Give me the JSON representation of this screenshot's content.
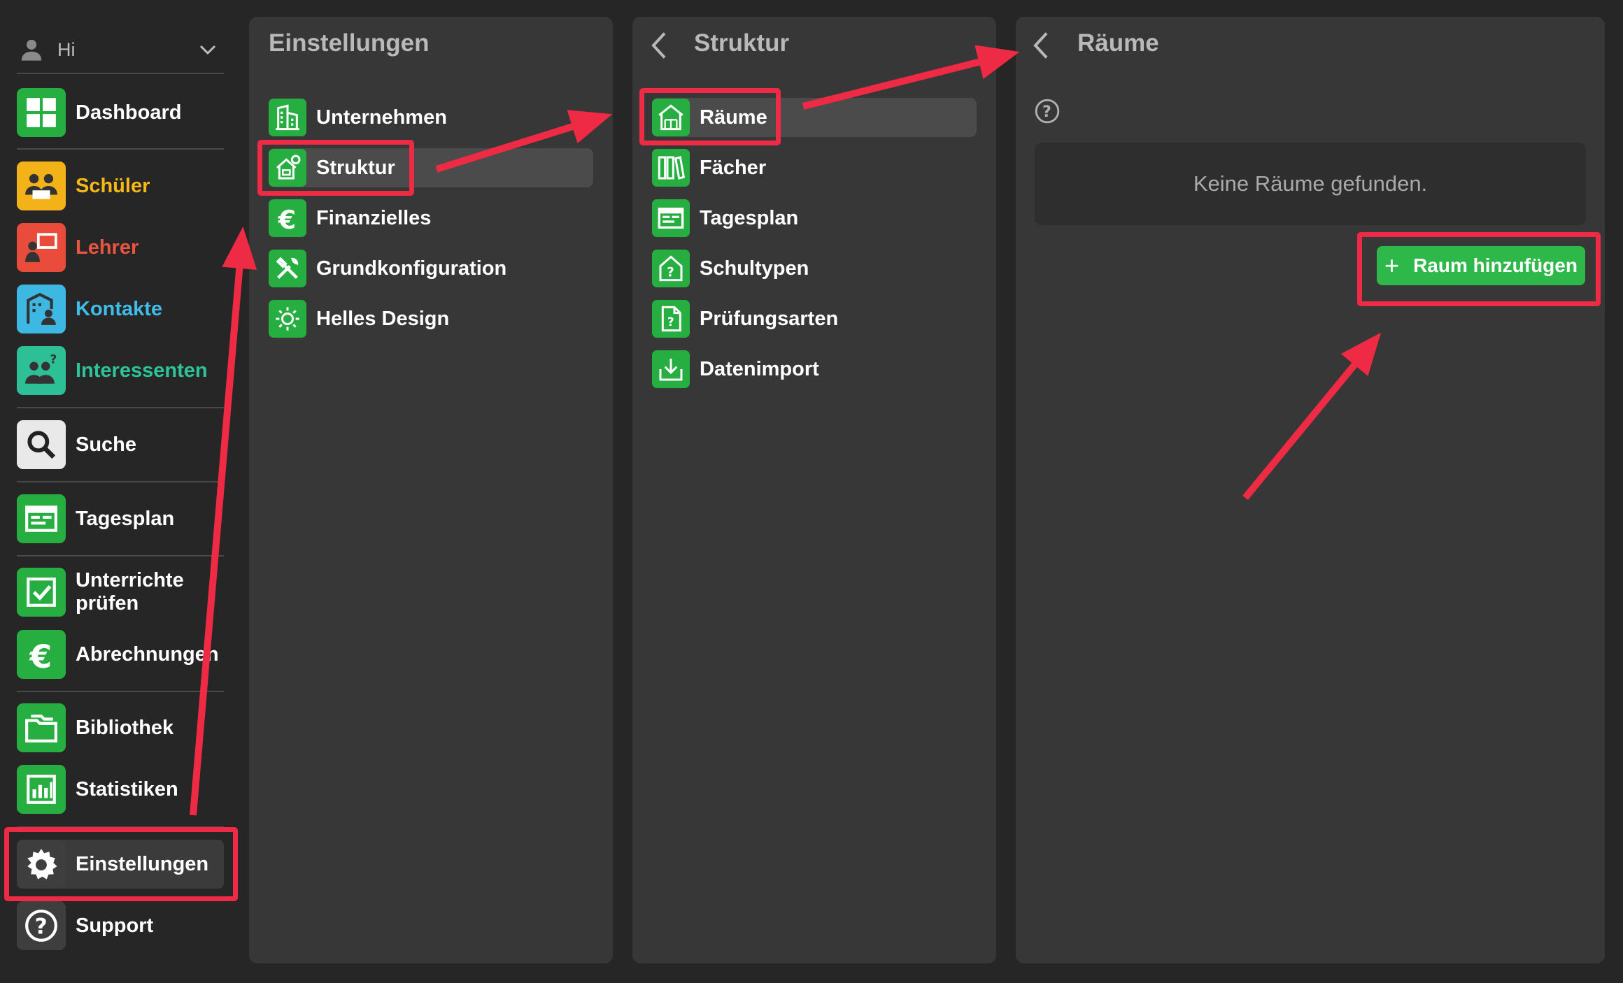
{
  "user": {
    "name": "Hi",
    "icon": "person-icon"
  },
  "sidebar": {
    "items": [
      {
        "label": "Dashboard",
        "color": "#ffffff",
        "icon": "dashboard-icon",
        "bg": "#27ae41"
      },
      {
        "label": "Schüler",
        "color": "#f5b819",
        "icon": "students-icon",
        "bg": "#f3b218"
      },
      {
        "label": "Lehrer",
        "color": "#ea5540",
        "icon": "teacher-icon",
        "bg": "#e94c3a"
      },
      {
        "label": "Kontakte",
        "color": "#3fbde8",
        "icon": "contacts-icon",
        "bg": "#3db8e3"
      },
      {
        "label": "Interessenten",
        "color": "#2ec49a",
        "icon": "prospects-icon",
        "bg": "#2dbf95"
      },
      {
        "label": "Suche",
        "color": "#ffffff",
        "icon": "search-icon",
        "bg": "#e9e9e9"
      },
      {
        "label": "Tagesplan",
        "color": "#ffffff",
        "icon": "dayplan-icon",
        "bg": "#27ae41"
      },
      {
        "label": "Unterrichte prüfen",
        "color": "#ffffff",
        "icon": "checkbox-icon",
        "bg": "#27ae41"
      },
      {
        "label": "Abrechnungen",
        "color": "#ffffff",
        "icon": "euro-icon",
        "bg": "#27ae41"
      },
      {
        "label": "Bibliothek",
        "color": "#ffffff",
        "icon": "folder-icon",
        "bg": "#27ae41"
      },
      {
        "label": "Statistiken",
        "color": "#ffffff",
        "icon": "stats-icon",
        "bg": "#27ae41"
      },
      {
        "label": "Einstellungen",
        "color": "#ffffff",
        "icon": "gear-icon",
        "bg": "#3e3e3e",
        "active": true
      },
      {
        "label": "Support",
        "color": "#ffffff",
        "icon": "support-icon",
        "bg": "#3e3e3e"
      }
    ]
  },
  "settings_panel": {
    "title": "Einstellungen",
    "items": [
      {
        "label": "Unternehmen",
        "icon": "building-icon"
      },
      {
        "label": "Struktur",
        "icon": "house-gear-icon",
        "selected": true
      },
      {
        "label": "Finanzielles",
        "icon": "euro-icon"
      },
      {
        "label": "Grundkonfiguration",
        "icon": "tools-icon"
      },
      {
        "label": "Helles Design",
        "icon": "sun-icon"
      }
    ]
  },
  "structure_panel": {
    "title": "Struktur",
    "items": [
      {
        "label": "Räume",
        "icon": "rooms-icon",
        "selected": true
      },
      {
        "label": "Fächer",
        "icon": "binders-icon"
      },
      {
        "label": "Tagesplan",
        "icon": "dayplan-icon"
      },
      {
        "label": "Schultypen",
        "icon": "school-type-icon"
      },
      {
        "label": "Prüfungsarten",
        "icon": "exam-doc-icon"
      },
      {
        "label": "Datenimport",
        "icon": "import-icon"
      }
    ]
  },
  "rooms_panel": {
    "title": "Räume",
    "empty_text": "Keine Räume gefunden.",
    "add_button": {
      "plus": "+",
      "label": "Raum hinzufügen"
    }
  },
  "annotation_color": "#ee2a44"
}
